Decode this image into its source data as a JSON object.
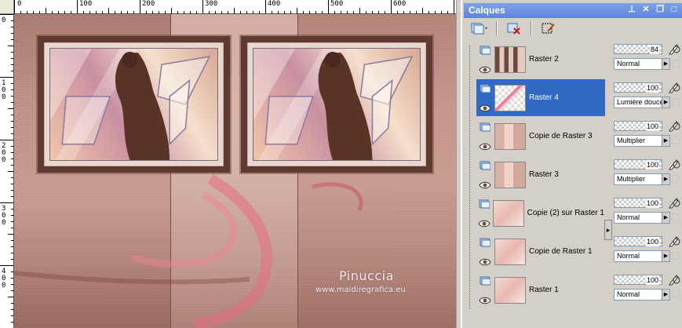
{
  "ruler": {
    "top_labels": [
      "0",
      "100",
      "200",
      "300",
      "400",
      "500",
      "600"
    ],
    "left_labels": [
      "0",
      "100",
      "200",
      "300",
      "400"
    ]
  },
  "watermark": {
    "title": "Pinuccia",
    "url": "www.maidiregrafica.eu"
  },
  "panel": {
    "title": "Calques",
    "title_buttons": [
      "pin-icon",
      "close-icon",
      "restore-icon",
      "maximize-icon"
    ]
  },
  "toolbar": {
    "tools": [
      "new-layer-icon",
      "delete-layer-icon",
      "mask-icon"
    ]
  },
  "layers": [
    {
      "name": "Raster 2",
      "opacity": "84",
      "blend": "Normal",
      "selected": false,
      "thumb": "frame"
    },
    {
      "name": "Raster 4",
      "opacity": "100",
      "blend": "Lumière douce",
      "selected": true,
      "thumb": "swirl"
    },
    {
      "name": "Copie de Raster 3",
      "opacity": "100",
      "blend": "Multiplier",
      "selected": false,
      "thumb": "stripes"
    },
    {
      "name": "Raster 3",
      "opacity": "100",
      "blend": "Multiplier",
      "selected": false,
      "thumb": "stripes"
    },
    {
      "name": "Copie (2) sur Raster 1",
      "opacity": "100",
      "blend": "Normal",
      "selected": false,
      "thumb": "soft"
    },
    {
      "name": "Copie de Raster 1",
      "opacity": "100",
      "blend": "Normal",
      "selected": false,
      "thumb": "soft"
    },
    {
      "name": "Raster 1",
      "opacity": "100",
      "blend": "Normal",
      "selected": false,
      "thumb": "soft"
    }
  ],
  "colors": {
    "selection": "#316ac5",
    "panel_title": "#5d86d8"
  }
}
